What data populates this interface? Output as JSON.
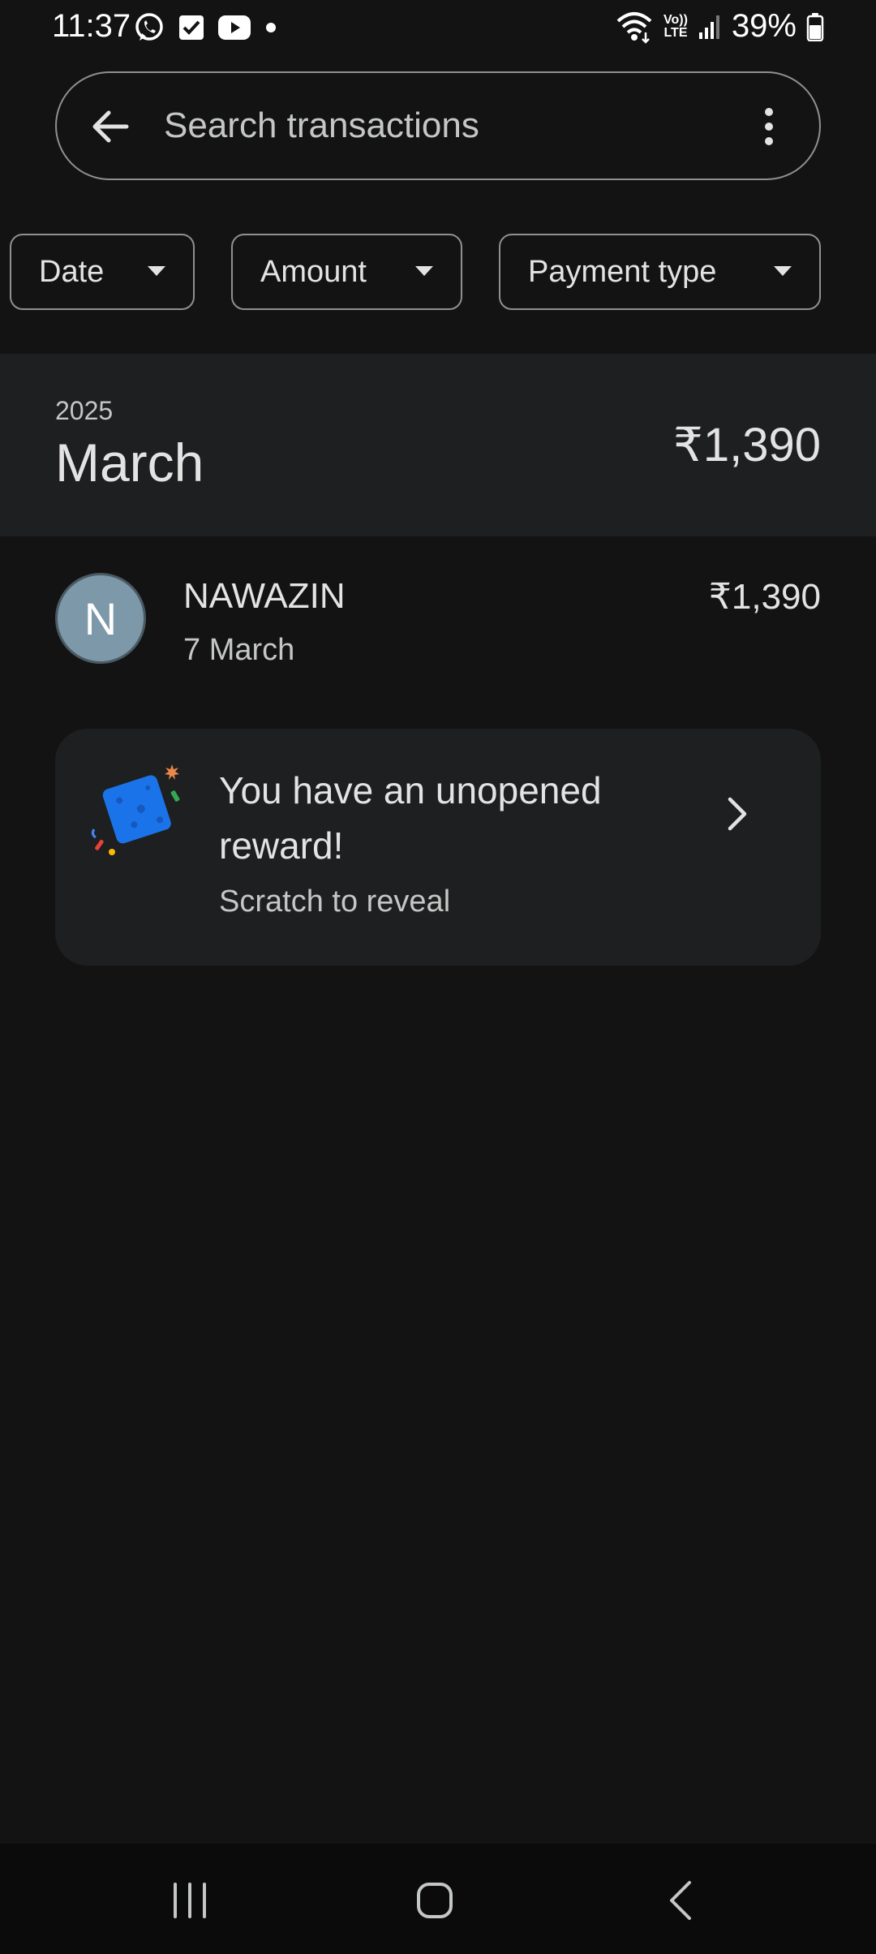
{
  "status_bar": {
    "time": "11:37",
    "left_icons": [
      "whatsapp-icon",
      "checkbox-icon",
      "youtube-icon",
      "dot-icon"
    ],
    "right_icons": [
      "wifi-icon",
      "volte-icon",
      "signal-icon",
      "battery-icon"
    ],
    "lte_top": "Vo))",
    "lte_bottom": "LTE",
    "battery": "39%"
  },
  "search": {
    "placeholder": "Search transactions",
    "value": ""
  },
  "filters": [
    {
      "label": "Date"
    },
    {
      "label": "Amount"
    },
    {
      "label": "Payment type"
    }
  ],
  "month_group": {
    "year": "2025",
    "month": "March",
    "total": "₹1,390"
  },
  "transactions": [
    {
      "initial": "N",
      "name": "NAWAZIN",
      "date": "7 March",
      "amount": "₹1,390"
    }
  ],
  "reward": {
    "title": "You have an unopened reward!",
    "subtitle": "Scratch to reveal"
  },
  "colors": {
    "background": "#131314",
    "surface": "#1e1f20",
    "outline": "#8e918f",
    "avatar": "#7d98a8",
    "reward_blue": "#1a73e8"
  }
}
